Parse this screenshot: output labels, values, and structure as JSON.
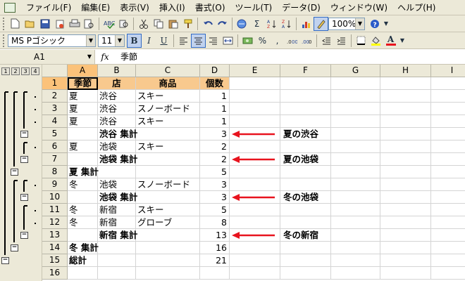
{
  "menu": [
    "ファイル(F)",
    "編集(E)",
    "表示(V)",
    "挿入(I)",
    "書式(O)",
    "ツール(T)",
    "データ(D)",
    "ウィンドウ(W)",
    "ヘルプ(H)"
  ],
  "toolbar": {
    "zoom": "100%",
    "font_name": "MS Pゴシック",
    "font_size": "11",
    "bold_label": "B",
    "italic_label": "I",
    "underline_label": "U",
    "percent_label": "%",
    "comma_label": ",",
    "sigma_label": "Σ",
    "font_color_label": "A"
  },
  "formula_bar": {
    "name_box": "A1",
    "fx": "fx",
    "content": "季節"
  },
  "outline_levels": [
    "1",
    "2",
    "3",
    "4"
  ],
  "columns": [
    "A",
    "B",
    "C",
    "D",
    "E",
    "F",
    "G",
    "H",
    "I"
  ],
  "rows": [
    {
      "n": "1",
      "a": "季節",
      "b": "店",
      "c": "商品",
      "d": "個数"
    },
    {
      "n": "2",
      "a": "夏",
      "b": "渋谷",
      "c": "スキー",
      "d": "1"
    },
    {
      "n": "3",
      "a": "夏",
      "b": "渋谷",
      "c": "スノーボード",
      "d": "1"
    },
    {
      "n": "4",
      "a": "夏",
      "b": "渋谷",
      "c": "スキー",
      "d": "1"
    },
    {
      "n": "5",
      "a": "",
      "b": "渋谷 集計",
      "c": "",
      "d": "3"
    },
    {
      "n": "6",
      "a": "夏",
      "b": "池袋",
      "c": "スキー",
      "d": "2"
    },
    {
      "n": "7",
      "a": "",
      "b": "池袋 集計",
      "c": "",
      "d": "2"
    },
    {
      "n": "8",
      "a": "夏 集計",
      "b": "",
      "c": "",
      "d": "5"
    },
    {
      "n": "9",
      "a": "冬",
      "b": "池袋",
      "c": "スノーボード",
      "d": "3"
    },
    {
      "n": "10",
      "a": "",
      "b": "池袋 集計",
      "c": "",
      "d": "3"
    },
    {
      "n": "11",
      "a": "冬",
      "b": "新宿",
      "c": "スキー",
      "d": "5"
    },
    {
      "n": "12",
      "a": "冬",
      "b": "新宿",
      "c": "グローブ",
      "d": "8"
    },
    {
      "n": "13",
      "a": "",
      "b": "新宿 集計",
      "c": "",
      "d": "13"
    },
    {
      "n": "14",
      "a": "冬 集計",
      "b": "",
      "c": "",
      "d": "16"
    },
    {
      "n": "15",
      "a": "総計",
      "b": "",
      "c": "",
      "d": "21"
    },
    {
      "n": "16",
      "a": "",
      "b": "",
      "c": "",
      "d": ""
    }
  ],
  "annotations": [
    "夏の渋谷",
    "夏の池袋",
    "冬の池袋",
    "冬の新宿"
  ],
  "colors": {
    "header_fill": "#f8c98e",
    "arrow": "#e8131e",
    "selected_header": "#fbc27a"
  },
  "outline_collapse_symbol": "−"
}
